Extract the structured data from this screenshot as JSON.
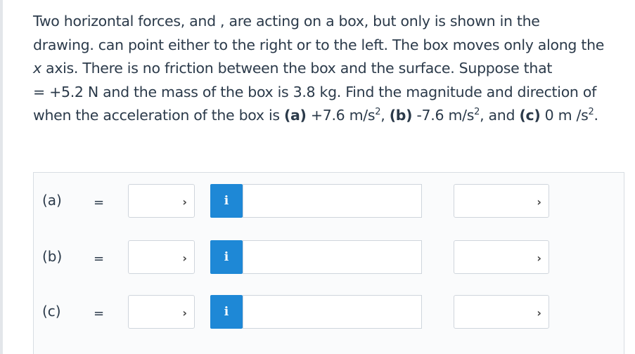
{
  "problem": {
    "line1": "Two horizontal forces,  and , are acting on a box, but only  is shown in the",
    "line2": "drawing.  can point either to the right or to the left. The box moves only along the",
    "line3_italic": "x",
    "line3_rest": " axis. There is no friction between the box and the surface. Suppose that",
    "line4": " = +5.2 N and the mass of the box is 3.8  kg. Find the magnitude and direction of",
    "line5_pre": "when the acceleration of the box is ",
    "part_a_tag": "(a)",
    "part_a_value": " +7.6 m/s",
    "sep1": ", ",
    "part_b_tag": "(b)",
    "part_b_value": " -7.6 m/s",
    "sep2": ", and ",
    "part_c_tag": "(c)",
    "part_c_value": " 0 m /s",
    "superscript": "2",
    "end": "."
  },
  "rows": [
    {
      "label": "(a)",
      "equals": "=",
      "info": "i",
      "value": "",
      "chevron": "›"
    },
    {
      "label": "(b)",
      "equals": "=",
      "info": "i",
      "value": "",
      "chevron": "›"
    },
    {
      "label": "(c)",
      "equals": "=",
      "info": "i",
      "value": "",
      "chevron": "›"
    }
  ],
  "colors": {
    "info_button": "#1e88d6",
    "text": "#2b3a4a",
    "border": "#cfd5dc"
  }
}
